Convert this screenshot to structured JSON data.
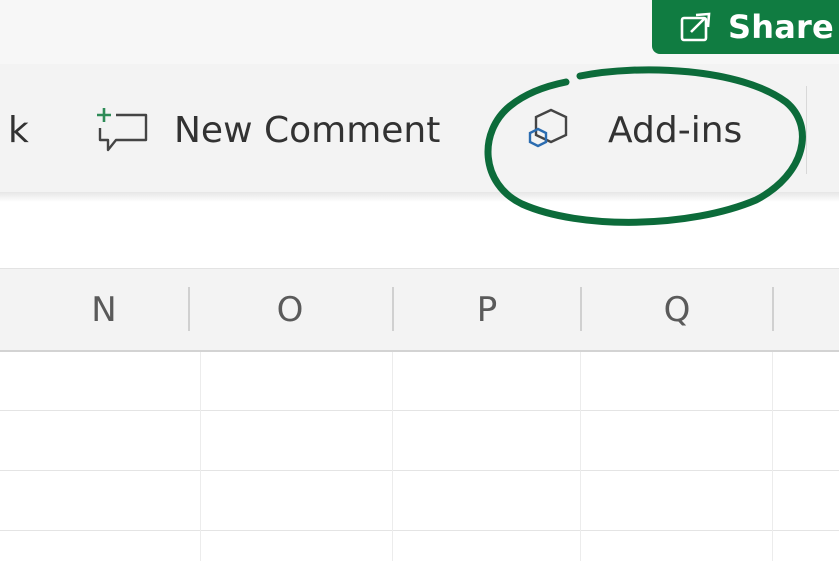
{
  "share": {
    "label": "Share",
    "icon": "share-icon",
    "color": "#107c41"
  },
  "ribbon": {
    "link_fragment": "k",
    "new_comment": {
      "label": "New Comment",
      "icon": "new-comment-icon"
    },
    "addins": {
      "label": "Add-ins",
      "icon": "addins-icon"
    }
  },
  "grid": {
    "columns": [
      "N",
      "O",
      "P",
      "Q"
    ]
  },
  "annotation": {
    "color": "#0c6b3a"
  }
}
